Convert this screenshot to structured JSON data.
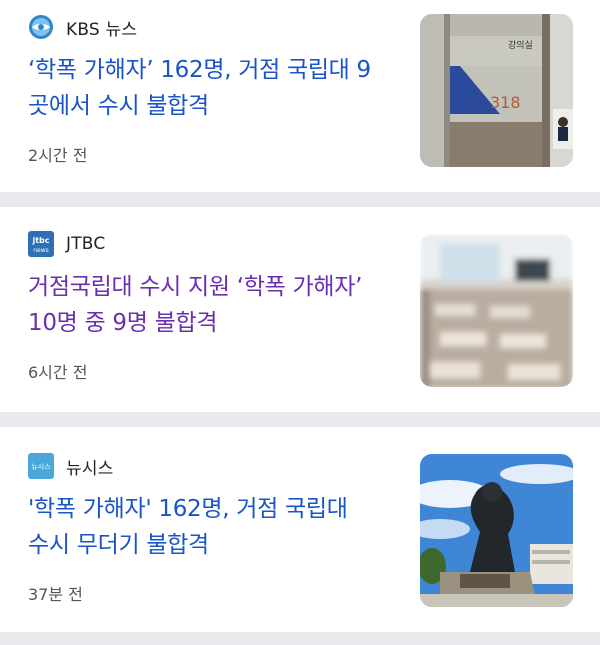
{
  "articles": [
    {
      "source": "KBS 뉴스",
      "source_icon": "kbs-logo-icon",
      "headline_line1": "‘학폭 가해자’ 162명, 거점 국립대 9",
      "headline_line2": "곳에서 수시 불합격",
      "time": "2시간 전",
      "headline_color": "#1a54c8",
      "thumbnail": {
        "sign_label": "강의실",
        "room_number": "318"
      }
    },
    {
      "source": "JTBC",
      "source_icon": "jtbc-logo-icon",
      "logo_text_top": "jtbc",
      "logo_text_bottom": "news",
      "headline_line1": "거점국립대 수시 지원 ‘학폭 가해자’",
      "headline_line2": "10명 중 9명 불합격",
      "time": "6시간 전",
      "headline_color": "#6a2fb0"
    },
    {
      "source": "뉴시스",
      "source_icon": "newsis-logo-icon",
      "logo_text": "뉴시스",
      "headline_line1": "'학폭 가해자' 162명, 거점 국립대",
      "headline_line2": "수시 무더기 불합격",
      "time": "37분 전",
      "headline_color": "#1a54c8"
    }
  ]
}
